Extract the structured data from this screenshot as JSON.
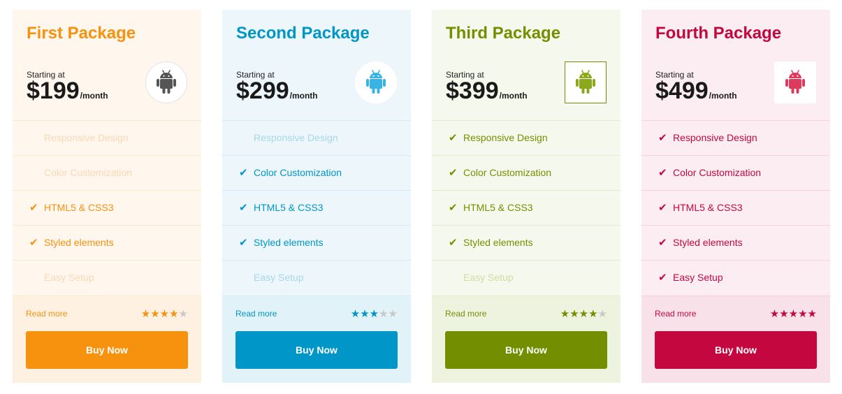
{
  "packages": [
    {
      "title": "First Package",
      "starting": "Starting at",
      "price": "$199",
      "period": "/month",
      "icon": "android-icon",
      "badge_shape": "circle",
      "colors": {
        "accent": "#f7920f",
        "bg": "#fff6ed",
        "footer": "#fef1e2",
        "border": "#fbe6cf",
        "faded": "#f9d8b4",
        "icon": "#555555"
      },
      "features": [
        {
          "label": "Responsive Design",
          "included": false
        },
        {
          "label": "Color Customization",
          "included": false
        },
        {
          "label": "HTML5 & CSS3",
          "included": true
        },
        {
          "label": "Styled elements",
          "included": true
        },
        {
          "label": "Easy Setup",
          "included": false
        }
      ],
      "read_more": "Read more",
      "rating": 4,
      "buy_label": "Buy Now"
    },
    {
      "title": "Second Package",
      "starting": "Starting at",
      "price": "$299",
      "period": "/month",
      "icon": "android-icon",
      "badge_shape": "circle",
      "colors": {
        "accent": "#0096c8",
        "bg": "#edf7fb",
        "footer": "#e2f2f9",
        "border": "#d3e9f3",
        "faded": "#a6d6ea",
        "icon": "#37b4e6"
      },
      "features": [
        {
          "label": "Responsive Design",
          "included": false
        },
        {
          "label": "Color Customization",
          "included": true
        },
        {
          "label": "HTML5 & CSS3",
          "included": true
        },
        {
          "label": "Styled elements",
          "included": true
        },
        {
          "label": "Easy Setup",
          "included": false
        }
      ],
      "read_more": "Read more",
      "rating": 3,
      "buy_label": "Buy Now"
    },
    {
      "title": "Third Package",
      "starting": "Starting at",
      "price": "$399",
      "period": "/month",
      "icon": "android-icon",
      "badge_shape": "square-outline",
      "colors": {
        "accent": "#738f00",
        "bg": "#f5f8ec",
        "footer": "#eef3e0",
        "border": "#e3ebcc",
        "faded": "#cfdca4",
        "icon": "#8aa81a"
      },
      "features": [
        {
          "label": "Responsive Design",
          "included": true
        },
        {
          "label": "Color Customization",
          "included": true
        },
        {
          "label": "HTML5 & CSS3",
          "included": true
        },
        {
          "label": "Styled elements",
          "included": true
        },
        {
          "label": "Easy Setup",
          "included": false
        }
      ],
      "read_more": "Read more",
      "rating": 4,
      "buy_label": "Buy Now"
    },
    {
      "title": "Fourth Package",
      "starting": "Starting at",
      "price": "$499",
      "period": "/month",
      "icon": "android-icon",
      "badge_shape": "square",
      "colors": {
        "accent": "#c4073f",
        "bg": "#fbedf2",
        "footer": "#f9e1ea",
        "border": "#f2d3df",
        "faded": "#e6a6bd",
        "icon": "#e0395e"
      },
      "features": [
        {
          "label": "Responsive Design",
          "included": true
        },
        {
          "label": "Color Customization",
          "included": true
        },
        {
          "label": "HTML5 & CSS3",
          "included": true
        },
        {
          "label": "Styled elements",
          "included": true
        },
        {
          "label": "Easy Setup",
          "included": true
        }
      ],
      "read_more": "Read more",
      "rating": 5,
      "buy_label": "Buy Now"
    }
  ]
}
